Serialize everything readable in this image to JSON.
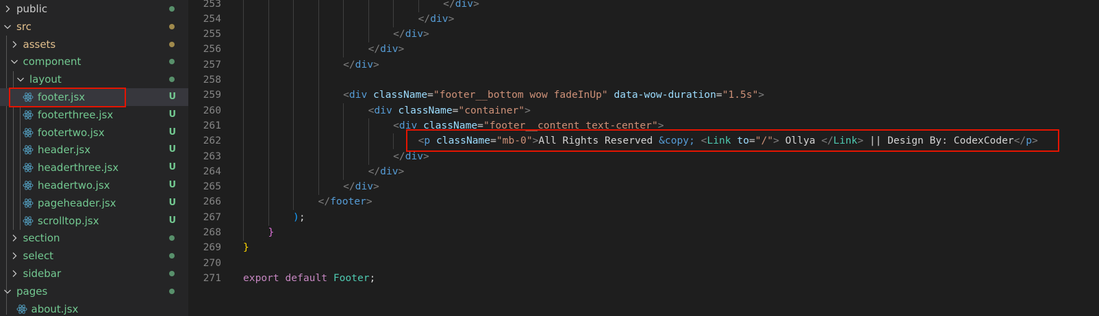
{
  "colors": {
    "folder_label": "#cccccc",
    "folder_src": "#e2c08d",
    "untracked_file": "#73c991",
    "dot_green": "#73c991",
    "dot_yellow": "#a08a4c",
    "highlight_box": "#e51400"
  },
  "explorer": {
    "rows": [
      {
        "label": "public",
        "type": "folder",
        "expanded": false,
        "depth": 0,
        "status": "",
        "dot": "green",
        "color": "#cccccc"
      },
      {
        "label": "src",
        "type": "folder",
        "expanded": true,
        "depth": 0,
        "status": "",
        "dot": "yellow",
        "color": "#e2c08d"
      },
      {
        "label": "assets",
        "type": "folder",
        "expanded": false,
        "depth": 1,
        "status": "",
        "dot": "yellow",
        "color": "#e2c08d"
      },
      {
        "label": "component",
        "type": "folder",
        "expanded": true,
        "depth": 1,
        "status": "",
        "dot": "green",
        "color": "#73c991"
      },
      {
        "label": "layout",
        "type": "folder",
        "expanded": true,
        "depth": 2,
        "status": "",
        "dot": "green",
        "color": "#73c991"
      },
      {
        "label": "footer.jsx",
        "type": "file",
        "depth": 2,
        "status": "U",
        "dot": "",
        "color": "#73c991",
        "selected": true
      },
      {
        "label": "footerthree.jsx",
        "type": "file",
        "depth": 2,
        "status": "U",
        "dot": "",
        "color": "#73c991"
      },
      {
        "label": "footertwo.jsx",
        "type": "file",
        "depth": 2,
        "status": "U",
        "dot": "",
        "color": "#73c991"
      },
      {
        "label": "header.jsx",
        "type": "file",
        "depth": 2,
        "status": "U",
        "dot": "",
        "color": "#73c991"
      },
      {
        "label": "headerthree.jsx",
        "type": "file",
        "depth": 2,
        "status": "U",
        "dot": "",
        "color": "#73c991"
      },
      {
        "label": "headertwo.jsx",
        "type": "file",
        "depth": 2,
        "status": "U",
        "dot": "",
        "color": "#73c991"
      },
      {
        "label": "pageheader.jsx",
        "type": "file",
        "depth": 2,
        "status": "U",
        "dot": "",
        "color": "#73c991"
      },
      {
        "label": "scrolltop.jsx",
        "type": "file",
        "depth": 2,
        "status": "U",
        "dot": "",
        "color": "#73c991"
      },
      {
        "label": "section",
        "type": "folder",
        "expanded": false,
        "depth": 1,
        "status": "",
        "dot": "green",
        "color": "#73c991"
      },
      {
        "label": "select",
        "type": "folder",
        "expanded": false,
        "depth": 1,
        "status": "",
        "dot": "green",
        "color": "#73c991"
      },
      {
        "label": "sidebar",
        "type": "folder",
        "expanded": false,
        "depth": 1,
        "status": "",
        "dot": "green",
        "color": "#73c991"
      },
      {
        "label": "pages",
        "type": "folder",
        "expanded": true,
        "depth": 0,
        "status": "",
        "dot": "green",
        "color": "#73c991"
      },
      {
        "label": "about.jsx",
        "type": "file",
        "depth": 1,
        "status": "",
        "dot": "",
        "color": "#73c991"
      }
    ]
  },
  "editor": {
    "lines": [
      {
        "num": "253",
        "indent": 8,
        "tokens": [
          [
            "br",
            "</"
          ],
          [
            "tag",
            "div"
          ],
          [
            "br",
            ">"
          ]
        ]
      },
      {
        "num": "254",
        "indent": 7,
        "tokens": [
          [
            "br",
            "</"
          ],
          [
            "tag",
            "div"
          ],
          [
            "br",
            ">"
          ]
        ]
      },
      {
        "num": "255",
        "indent": 6,
        "tokens": [
          [
            "br",
            "</"
          ],
          [
            "tag",
            "div"
          ],
          [
            "br",
            ">"
          ]
        ]
      },
      {
        "num": "256",
        "indent": 5,
        "tokens": [
          [
            "br",
            "</"
          ],
          [
            "tag",
            "div"
          ],
          [
            "br",
            ">"
          ]
        ]
      },
      {
        "num": "257",
        "indent": 4,
        "tokens": [
          [
            "br",
            "</"
          ],
          [
            "tag",
            "div"
          ],
          [
            "br",
            ">"
          ]
        ]
      },
      {
        "num": "258",
        "indent": 4,
        "tokens": []
      },
      {
        "num": "259",
        "indent": 4,
        "tokens": [
          [
            "br",
            "<"
          ],
          [
            "tag",
            "div"
          ],
          [
            "txt",
            " "
          ],
          [
            "attr",
            "className"
          ],
          [
            "txt",
            "="
          ],
          [
            "str",
            "\"footer__bottom wow fadeInUp\""
          ],
          [
            "txt",
            " "
          ],
          [
            "attr",
            "data-wow-duration"
          ],
          [
            "txt",
            "="
          ],
          [
            "str",
            "\"1.5s\""
          ],
          [
            "br",
            ">"
          ]
        ]
      },
      {
        "num": "260",
        "indent": 5,
        "tokens": [
          [
            "br",
            "<"
          ],
          [
            "tag",
            "div"
          ],
          [
            "txt",
            " "
          ],
          [
            "attr",
            "className"
          ],
          [
            "txt",
            "="
          ],
          [
            "str",
            "\"container\""
          ],
          [
            "br",
            ">"
          ]
        ]
      },
      {
        "num": "261",
        "indent": 6,
        "tokens": [
          [
            "br",
            "<"
          ],
          [
            "tag",
            "div"
          ],
          [
            "txt",
            " "
          ],
          [
            "attr",
            "className"
          ],
          [
            "txt",
            "="
          ],
          [
            "str",
            "\"footer__content text-center\""
          ],
          [
            "br",
            ">"
          ]
        ]
      },
      {
        "num": "262",
        "indent": 7,
        "tokens": [
          [
            "br",
            "<"
          ],
          [
            "tag",
            "p"
          ],
          [
            "txt",
            " "
          ],
          [
            "attr",
            "className"
          ],
          [
            "txt",
            "="
          ],
          [
            "str",
            "\"mb-0\""
          ],
          [
            "br",
            ">"
          ],
          [
            "txt",
            "All Rights Reserved "
          ],
          [
            "ent",
            "&copy;"
          ],
          [
            "txt",
            " "
          ],
          [
            "br",
            "<"
          ],
          [
            "id",
            "Link"
          ],
          [
            "txt",
            " "
          ],
          [
            "attr",
            "to"
          ],
          [
            "txt",
            "="
          ],
          [
            "str",
            "\"/\""
          ],
          [
            "br",
            ">"
          ],
          [
            "txt",
            " Ollya "
          ],
          [
            "br",
            "</"
          ],
          [
            "id",
            "Link"
          ],
          [
            "br",
            ">"
          ],
          [
            "txt",
            " || Design By: CodexCoder"
          ],
          [
            "br",
            "</"
          ],
          [
            "tag",
            "p"
          ],
          [
            "br",
            ">"
          ]
        ]
      },
      {
        "num": "263",
        "indent": 6,
        "tokens": [
          [
            "br",
            "</"
          ],
          [
            "tag",
            "div"
          ],
          [
            "br",
            ">"
          ]
        ]
      },
      {
        "num": "264",
        "indent": 5,
        "tokens": [
          [
            "br",
            "</"
          ],
          [
            "tag",
            "div"
          ],
          [
            "br",
            ">"
          ]
        ]
      },
      {
        "num": "265",
        "indent": 4,
        "tokens": [
          [
            "br",
            "</"
          ],
          [
            "tag",
            "div"
          ],
          [
            "br",
            ">"
          ]
        ]
      },
      {
        "num": "266",
        "indent": 3,
        "tokens": [
          [
            "br",
            "</"
          ],
          [
            "tag",
            "footer"
          ],
          [
            "br",
            ">"
          ]
        ]
      },
      {
        "num": "267",
        "indent": 2,
        "tokens": [
          [
            "p2",
            ")"
          ],
          [
            "txt",
            ";"
          ]
        ]
      },
      {
        "num": "268",
        "indent": 1,
        "tokens": [
          [
            "p1",
            "}"
          ]
        ]
      },
      {
        "num": "269",
        "indent": 0,
        "tokens": [
          [
            "p3",
            "}"
          ]
        ]
      },
      {
        "num": "270",
        "indent": 0,
        "tokens": []
      },
      {
        "num": "271",
        "indent": 0,
        "tokens": [
          [
            "kw",
            "export"
          ],
          [
            "txt",
            " "
          ],
          [
            "kw",
            "default"
          ],
          [
            "txt",
            " "
          ],
          [
            "id",
            "Footer"
          ],
          [
            "txt",
            ";"
          ]
        ]
      }
    ]
  }
}
